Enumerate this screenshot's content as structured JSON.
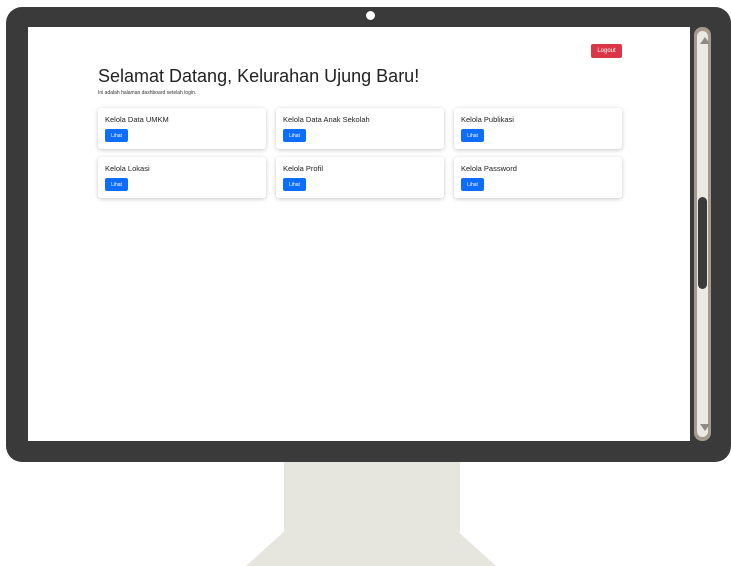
{
  "header": {
    "logout_label": "Logout",
    "title": "Selamat Datang, Kelurahan Ujung Baru!",
    "subtitle": "Ini adalah halaman dashboard setelah login."
  },
  "cards": [
    {
      "title": "Kelola Data UMKM",
      "button": "Lihat"
    },
    {
      "title": "Kelola Data Anak Sekolah",
      "button": "Lihat"
    },
    {
      "title": "Kelola Publikasi",
      "button": "Lihat"
    },
    {
      "title": "Kelola Lokasi",
      "button": "Lihat"
    },
    {
      "title": "Kelola Profil",
      "button": "Lihat"
    },
    {
      "title": "Kelola Password",
      "button": "Lihat"
    }
  ],
  "colors": {
    "logout": "#dc3545",
    "primary": "#0d6efd",
    "bezel": "#3a3a3a"
  }
}
